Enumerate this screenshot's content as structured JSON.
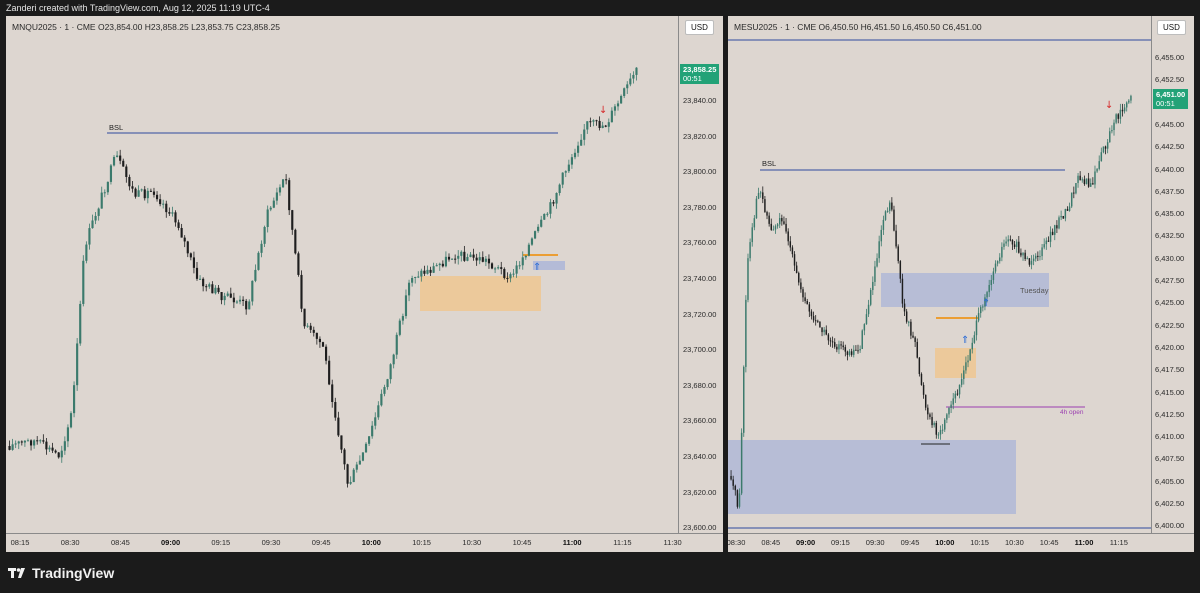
{
  "header": {
    "caption": "Zanderi created with TradingView.com, Aug 12, 2025 11:19 UTC-4"
  },
  "footer": {
    "brand": "TradingView",
    "logo_icon": "tradingview-logo-icon"
  },
  "colors": {
    "background": "#ddd6d0",
    "up": "#3b7a6c",
    "down": "#1e1e1e",
    "price_tag": "#22a277",
    "liquidity_line": "#2e4a9e",
    "fvg_orange": "#f0c48a",
    "fvg_blue": "#aab4d8",
    "open_line": "#9b3fb0"
  },
  "left_chart": {
    "legend": "MNQU2025 · 1 · CME  O23,854.00  H23,858.25  L23,853.75  C23,858.25",
    "currency": "USD",
    "price_tag": {
      "price": "23,858.25",
      "countdown": "00:51"
    },
    "y_labels": [
      "23,840.00",
      "23,820.00",
      "23,800.00",
      "23,780.00",
      "23,760.00",
      "23,740.00",
      "23,720.00",
      "23,700.00",
      "23,680.00",
      "23,660.00",
      "23,640.00",
      "23,620.00",
      "23,600.00"
    ],
    "x_labels": [
      {
        "t": "08:15",
        "bold": false
      },
      {
        "t": "08:30",
        "bold": false
      },
      {
        "t": "08:45",
        "bold": false
      },
      {
        "t": "09:00",
        "bold": true
      },
      {
        "t": "09:15",
        "bold": false
      },
      {
        "t": "09:30",
        "bold": false
      },
      {
        "t": "09:45",
        "bold": false
      },
      {
        "t": "10:00",
        "bold": true
      },
      {
        "t": "10:15",
        "bold": false
      },
      {
        "t": "10:30",
        "bold": false
      },
      {
        "t": "10:45",
        "bold": false
      },
      {
        "t": "11:00",
        "bold": true
      },
      {
        "t": "11:15",
        "bold": false
      },
      {
        "t": "11:30",
        "bold": false
      }
    ],
    "bsl_label": "BSL"
  },
  "right_chart": {
    "legend": "MESU2025 · 1 · CME  O6,450.50  H6,451.50  L6,450.50  C6,451.00",
    "currency": "USD",
    "price_tag": {
      "price": "6,451.00",
      "countdown": "00:51"
    },
    "y_labels": [
      "6,455.00",
      "6,452.50",
      "6,447.50",
      "6,445.00",
      "6,442.50",
      "6,440.00",
      "6,437.50",
      "6,435.00",
      "6,432.50",
      "6,430.00",
      "6,427.50",
      "6,425.00",
      "6,422.50",
      "6,420.00",
      "6,417.50",
      "6,415.00",
      "6,412.50",
      "6,410.00",
      "6,407.50",
      "6,405.00",
      "6,402.50",
      "6,400.00"
    ],
    "x_labels": [
      {
        "t": "08:30",
        "bold": false
      },
      {
        "t": "08:45",
        "bold": false
      },
      {
        "t": "09:00",
        "bold": true
      },
      {
        "t": "09:15",
        "bold": false
      },
      {
        "t": "09:30",
        "bold": false
      },
      {
        "t": "09:45",
        "bold": false
      },
      {
        "t": "10:00",
        "bold": true
      },
      {
        "t": "10:15",
        "bold": false
      },
      {
        "t": "10:30",
        "bold": false
      },
      {
        "t": "10:45",
        "bold": false
      },
      {
        "t": "11:00",
        "bold": true
      },
      {
        "t": "11:15",
        "bold": false
      }
    ],
    "bsl_label": "BSL",
    "tuesday_label": "Tuesday",
    "open_label": "4h open"
  }
}
